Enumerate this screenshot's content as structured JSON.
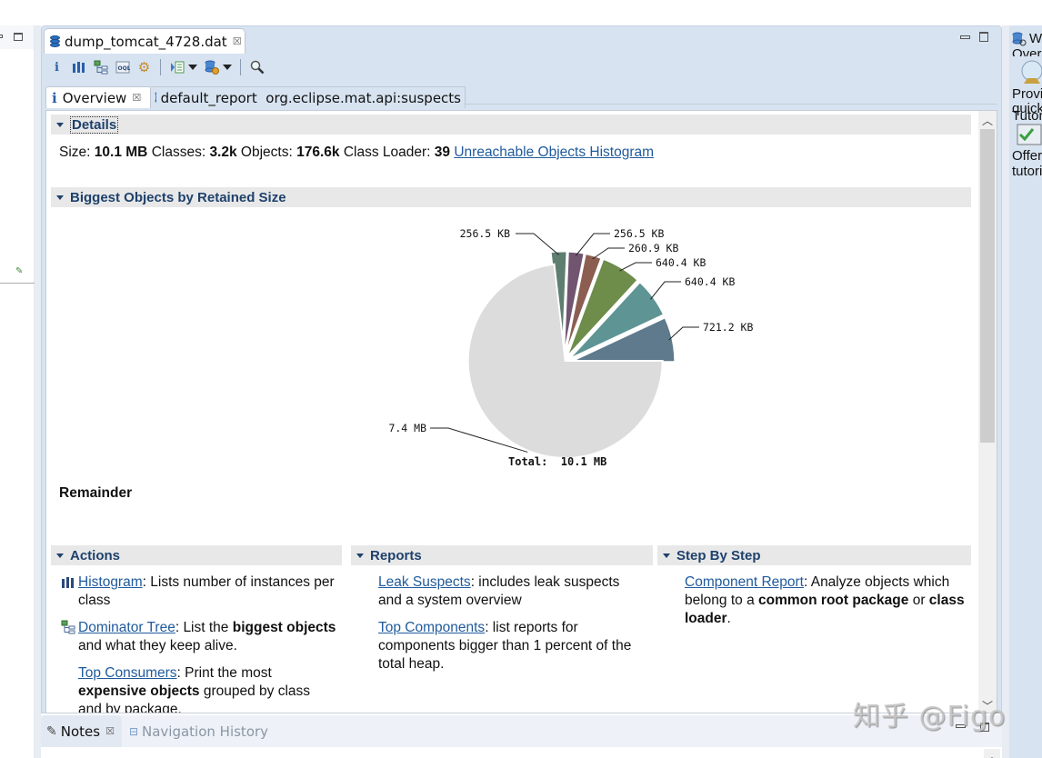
{
  "editor": {
    "tab_title": "dump_tomcat_4728.dat",
    "toolbar": {
      "buttons": [
        {
          "name": "overview-icon",
          "glyph": "i"
        },
        {
          "name": "histogram-icon",
          "glyph": "▮▮"
        },
        {
          "name": "dominator-tree-icon",
          "glyph": "⊞"
        },
        {
          "name": "oql-icon",
          "glyph": "OQL"
        },
        {
          "name": "heap-dump-details-icon",
          "glyph": "⚙"
        },
        {
          "name": "run-expert-report-icon",
          "glyph": "▶"
        },
        {
          "name": "query-browser-icon",
          "glyph": "⛁"
        },
        {
          "name": "find-object-icon",
          "glyph": "🔍"
        }
      ]
    },
    "subtabs": [
      {
        "label": "Overview",
        "icon": "info-icon",
        "active": true
      },
      {
        "label": "default_report  org.eclipse.mat.api:suspects",
        "icon": "report-icon",
        "active": false
      }
    ]
  },
  "details": {
    "header": "Details",
    "size_label": "Size:",
    "size_value": "10.1 MB",
    "classes_label": "Classes:",
    "classes_value": "3.2k",
    "objects_label": "Objects:",
    "objects_value": "176.6k",
    "classloader_label": "Class Loader:",
    "classloader_value": "39",
    "unreachable_link": "Unreachable Objects Histogram"
  },
  "biggest_objects": {
    "header": "Biggest Objects by Retained Size",
    "selected_label": "Remainder"
  },
  "chart_data": {
    "type": "pie",
    "title": "",
    "total_label": "Total:  10.1 MB",
    "unit": "KB",
    "slices": [
      {
        "label": "721.2 KB",
        "value": 721.2,
        "color": "#5e7a8c"
      },
      {
        "label": "640.4 KB",
        "value": 640.4,
        "color": "#5e9494"
      },
      {
        "label": "640.4 KB",
        "value": 640.4,
        "color": "#6e8c4a"
      },
      {
        "label": "260.9 KB",
        "value": 260.9,
        "color": "#8c5e52"
      },
      {
        "label": "256.5 KB",
        "value": 256.5,
        "color": "#705470"
      },
      {
        "label": "256.5 KB",
        "value": 256.5,
        "color": "#5e7e70"
      },
      {
        "label": "7.4 MB",
        "value": 7577.6,
        "color": "#dcdcdc",
        "exploded": false
      }
    ]
  },
  "actions": {
    "header": "Actions",
    "items": [
      {
        "link": "Histogram",
        "text_parts": [
          ": Lists number of instances per class"
        ],
        "icon": "histogram-icon"
      },
      {
        "link": "Dominator Tree",
        "text_parts": [
          ": List the ",
          "biggest objects",
          " and what they keep alive."
        ],
        "icon": "dominator-tree-icon"
      },
      {
        "link": "Top Consumers",
        "text_parts": [
          ": Print the most ",
          "expensive objects",
          " grouped by class and by package."
        ],
        "icon": ""
      }
    ]
  },
  "reports": {
    "header": "Reports",
    "items": [
      {
        "link": "Leak Suspects",
        "text": ": includes leak suspects and a system overview"
      },
      {
        "link": "Top Components",
        "text": ": list reports for components bigger than 1 percent of the total heap."
      }
    ]
  },
  "step_by_step": {
    "header": "Step By Step",
    "items": [
      {
        "link": "Component Report",
        "text_parts": [
          ": Analyze objects which belong to a ",
          "common root package",
          " or ",
          "class loader",
          "."
        ]
      }
    ]
  },
  "bottom_panel": {
    "tabs": [
      {
        "label": "Notes",
        "icon": "notes-icon",
        "active": true
      },
      {
        "label": "Navigation History",
        "icon": "navigation-history-icon",
        "active": false
      }
    ]
  },
  "right_panel": {
    "title": "W",
    "lines": [
      "Over",
      "Provi",
      "quick",
      "Tutor",
      "Offer",
      "tutori"
    ]
  },
  "watermark": "知乎 @Figo"
}
